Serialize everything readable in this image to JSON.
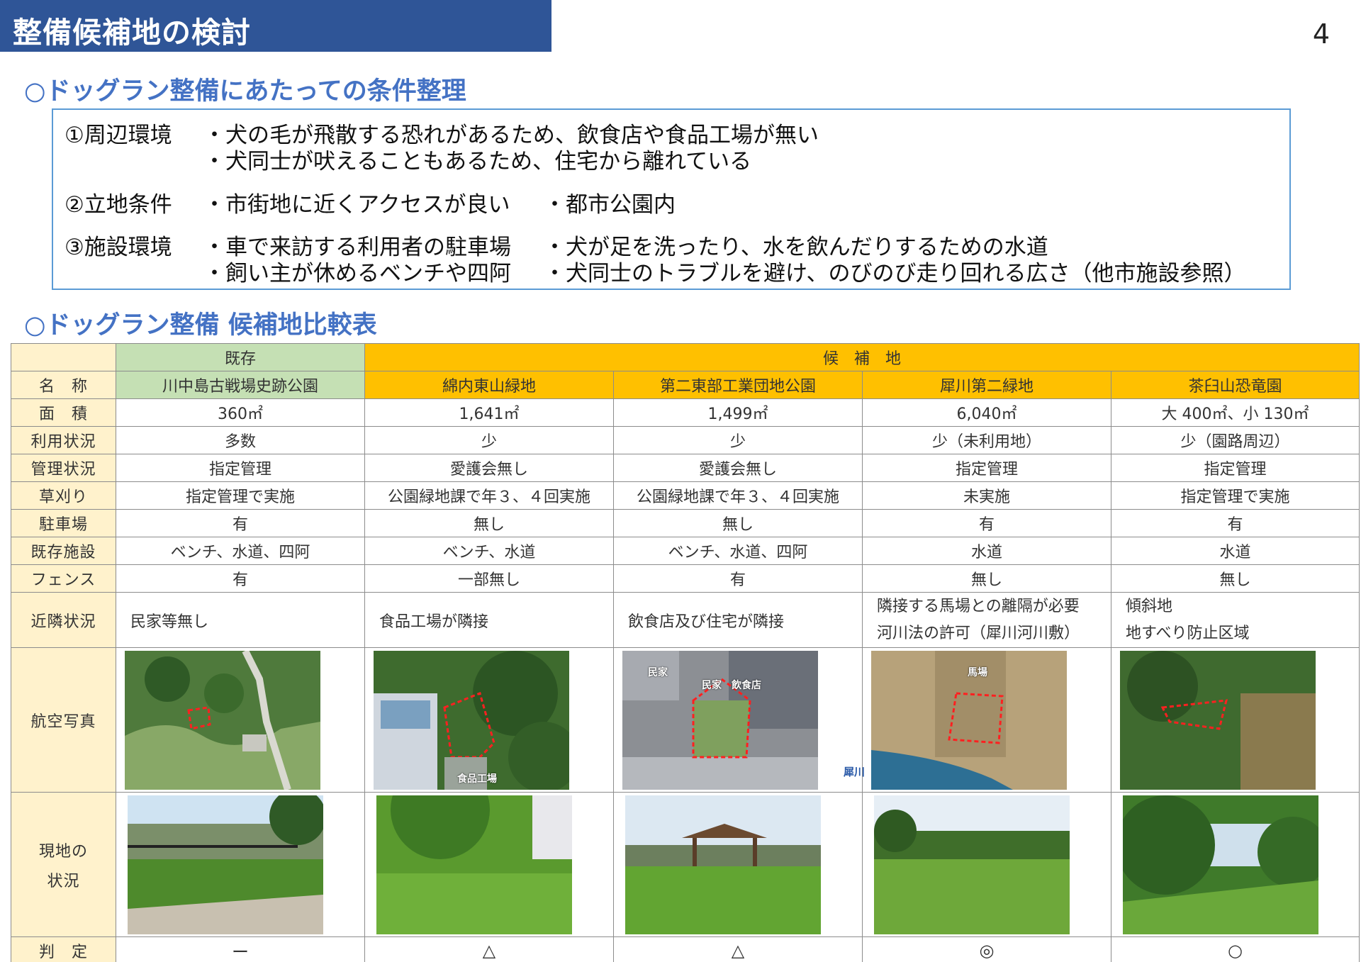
{
  "header": {
    "title": "整備候補地の検討",
    "page_number": "4"
  },
  "conditions": {
    "heading": "○ドッグラン整備にあたっての条件整理",
    "groups": [
      {
        "label": "①周辺環境",
        "items": [
          "・犬の毛が飛散する恐れがあるため、飲食店や食品工場が無い",
          "・犬同士が吠えることもあるため、住宅から離れている"
        ]
      },
      {
        "label": "②立地条件",
        "items": [
          "・市街地に近くアクセスが良い",
          "・都市公園内"
        ]
      },
      {
        "label": "③施設環境",
        "items": [
          "・車で来訪する利用者の駐車場",
          "・犬が足を洗ったり、水を飲んだりするための水道",
          "・飼い主が休めるベンチや四阿",
          "・犬同士のトラブルを避け、のびのび走り回れる広さ（他市施設参照）"
        ]
      }
    ]
  },
  "comparison": {
    "heading": "○ドッグラン整備 候補地比較表",
    "group_existing": "既存",
    "group_candidates": "候　補　地",
    "row_labels": {
      "name": "名　称",
      "area": "面　積",
      "usage": "利用状況",
      "management": "管理状況",
      "mowing": "草刈り",
      "parking": "駐車場",
      "facilities": "既存施設",
      "fence": "フェンス",
      "nearby": "近隣状況",
      "aerial": "航空写真",
      "site_line1": "現地の",
      "site_line2": "状況",
      "judgement": "判　定"
    },
    "sites": [
      {
        "name": "川中島古戦場史跡公園",
        "area": "360㎡",
        "usage": "多数",
        "management": "指定管理",
        "mowing": "指定管理で実施",
        "parking": "有",
        "facilities": "ベンチ、水道、四阿",
        "fence": "有",
        "nearby": [
          "民家等無し"
        ],
        "judgement": "ー"
      },
      {
        "name": "綿内東山緑地",
        "area": "1,641㎡",
        "usage": "少",
        "management": "愛護会無し",
        "mowing": "公園緑地課で年３、４回実施",
        "parking": "無し",
        "facilities": "ベンチ、水道",
        "fence": "一部無し",
        "nearby": [
          "食品工場が隣接"
        ],
        "judgement": "△"
      },
      {
        "name": "第二東部工業団地公園",
        "area": "1,499㎡",
        "usage": "少",
        "management": "愛護会無し",
        "mowing": "公園緑地課で年３、４回実施",
        "parking": "無し",
        "facilities": "ベンチ、水道、四阿",
        "fence": "有",
        "nearby": [
          "飲食店及び住宅が隣接"
        ],
        "judgement": "△"
      },
      {
        "name": "犀川第二緑地",
        "area": "6,040㎡",
        "usage": "少（未利用地）",
        "management": "指定管理",
        "mowing": "未実施",
        "parking": "有",
        "facilities": "水道",
        "fence": "無し",
        "nearby": [
          "隣接する馬場との離隔が必要",
          "河川法の許可（犀川河川敷）"
        ],
        "judgement": "◎"
      },
      {
        "name": "茶臼山恐竜園",
        "area": "大 400㎡、小 130㎡",
        "usage": "少（園路周辺）",
        "management": "指定管理",
        "mowing": "指定管理で実施",
        "parking": "有",
        "facilities": "水道",
        "fence": "無し",
        "nearby": [
          "傾斜地",
          "地すべり防止区域"
        ],
        "judgement": "○"
      }
    ],
    "photo_labels": {
      "factory": "食品工場",
      "house": "民家",
      "house2": "民家",
      "restaurant": "飲食店",
      "horse": "馬場",
      "river": "犀川"
    }
  }
}
